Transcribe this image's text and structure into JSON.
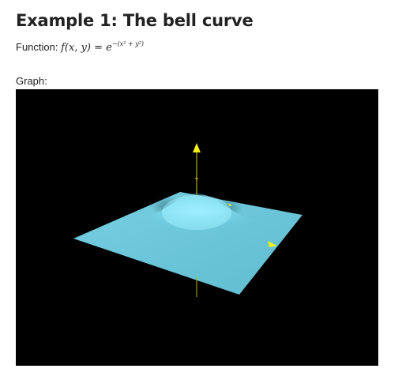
{
  "heading": {
    "title": "Example 1: The bell curve"
  },
  "function_line": {
    "label": "Function:",
    "formula_main": "f(x, y) = e",
    "formula_exponent": "−(x² + y²)"
  },
  "graph": {
    "label": "Graph:"
  },
  "colors": {
    "viewport_background": "#000000",
    "surface_light": "#8fe3f5",
    "surface_mid": "#6cc8dc",
    "surface_shadow": "#3f8a9a",
    "axis": "#d8d400",
    "arrow": "#f3ef19"
  }
}
